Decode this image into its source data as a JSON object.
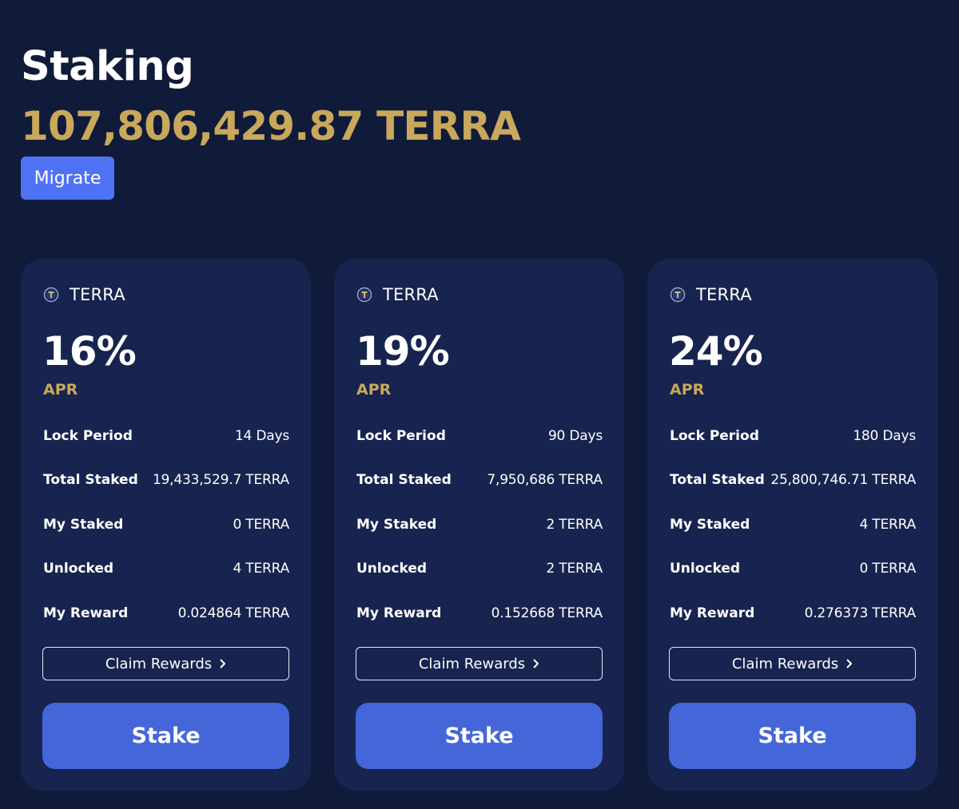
{
  "header": {
    "title": "Staking",
    "total_staked": "107,806,429.87 TERRA",
    "migrate_label": "Migrate"
  },
  "colors": {
    "background": "#101b3a",
    "card": "#17244f",
    "gold": "#c9a85c",
    "migrate_blue": "#4f72f5",
    "stake_blue": "#4566d8"
  },
  "labels": {
    "apr": "APR",
    "lock_period": "Lock Period",
    "total_staked": "Total Staked",
    "my_staked": "My Staked",
    "unlocked": "Unlocked",
    "my_reward": "My Reward",
    "claim_rewards": "Claim Rewards",
    "stake": "Stake"
  },
  "pools": [
    {
      "token": "TERRA",
      "icon": "terra-token-icon",
      "apr": "16%",
      "lock_period": "14 Days",
      "total_staked": "19,433,529.7 TERRA",
      "my_staked": "0 TERRA",
      "unlocked": "4 TERRA",
      "my_reward": "0.024864 TERRA"
    },
    {
      "token": "TERRA",
      "icon": "terra-token-icon",
      "apr": "19%",
      "lock_period": "90 Days",
      "total_staked": "7,950,686 TERRA",
      "my_staked": "2 TERRA",
      "unlocked": "2 TERRA",
      "my_reward": "0.152668 TERRA"
    },
    {
      "token": "TERRA",
      "icon": "terra-token-icon",
      "apr": "24%",
      "lock_period": "180 Days",
      "total_staked": "25,800,746.71 TERRA",
      "my_staked": "4 TERRA",
      "unlocked": "0 TERRA",
      "my_reward": "0.276373 TERRA"
    }
  ]
}
